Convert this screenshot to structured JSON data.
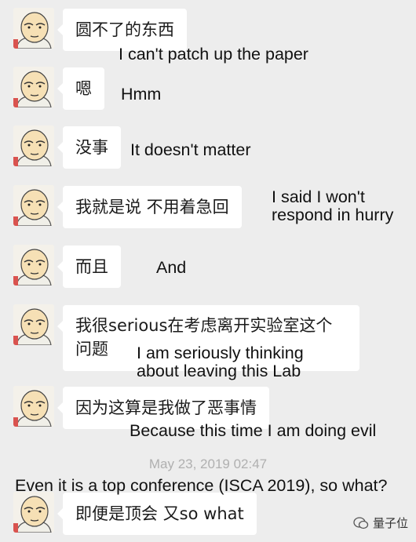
{
  "messages": [
    {
      "zh": "圆不了的东西",
      "en": "I can't patch up the paper"
    },
    {
      "zh": "嗯",
      "en": "Hmm"
    },
    {
      "zh": "没事",
      "en": "It doesn't matter"
    },
    {
      "zh": "我就是说 不用着急回",
      "en_1": "I said I won't",
      "en_2": "respond in hurry"
    },
    {
      "zh": "而且",
      "en": "And"
    },
    {
      "zh_1": "我很serious在考虑离开实验室这个",
      "zh_2": "问题",
      "en_1": "I am seriously thinking",
      "en_2": "about leaving this Lab"
    },
    {
      "zh": "因为这算是我做了恶事情",
      "en": "Because this time I am doing evil"
    },
    {
      "zh": "即便是顶会 又so what",
      "en": "Even it is a top conference (ISCA 2019), so what?"
    }
  ],
  "timestamp": "May 23, 2019 02:47",
  "watermark": "量子位",
  "colors": {
    "background": "#ededed",
    "bubble": "#ffffff",
    "timestamp": "#b0b0b0"
  }
}
